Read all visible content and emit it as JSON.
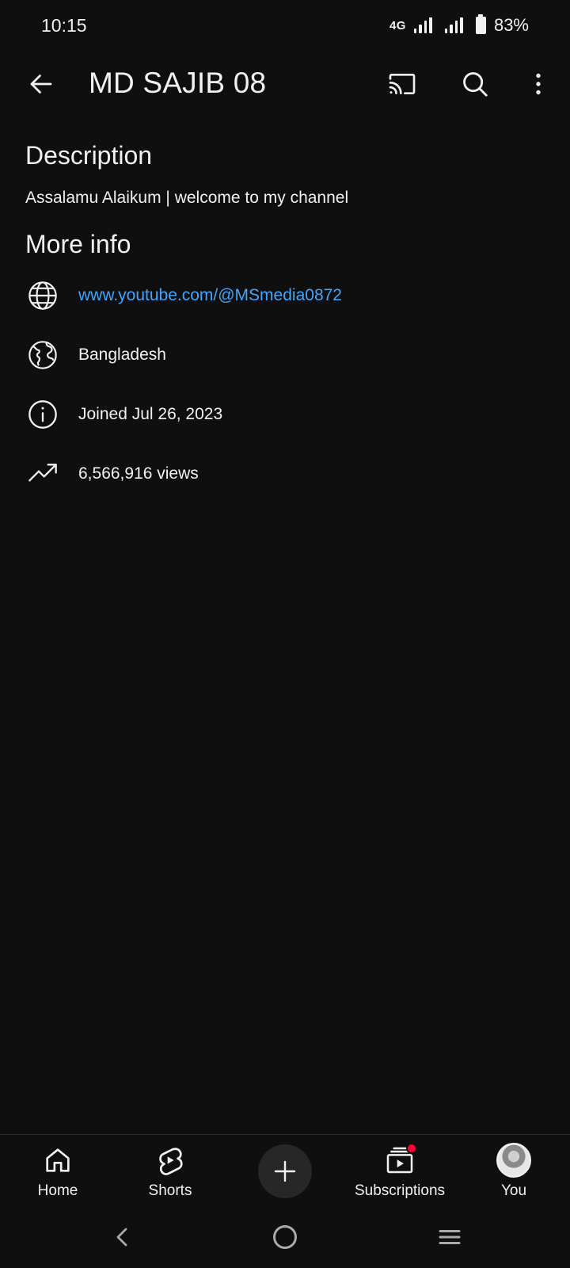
{
  "status_bar": {
    "time": "10:15",
    "network_type": "4G",
    "battery_percent": "83%"
  },
  "app_bar": {
    "title": "MD SAJIB 08",
    "icons": [
      "back-arrow-icon",
      "cast-icon",
      "search-icon",
      "more-vertical-icon"
    ]
  },
  "description": {
    "heading": "Description",
    "text": "Assalamu Alaikum | welcome to my channel"
  },
  "more_info": {
    "heading": "More info",
    "items": [
      {
        "icon": "globe-icon",
        "text": "www.youtube.com/@MSmedia0872",
        "is_link": true
      },
      {
        "icon": "earth-region-icon",
        "text": "Bangladesh",
        "is_link": false
      },
      {
        "icon": "info-icon",
        "text": "Joined Jul 26, 2023",
        "is_link": false
      },
      {
        "icon": "trending-up-icon",
        "text": "6,566,916 views",
        "is_link": false
      }
    ]
  },
  "bottom_nav": {
    "items": [
      {
        "label": "Home",
        "icon": "home-icon"
      },
      {
        "label": "Shorts",
        "icon": "shorts-icon"
      },
      {
        "label": "",
        "icon": "create-plus-icon"
      },
      {
        "label": "Subscriptions",
        "icon": "subscriptions-icon",
        "has_notification": true
      },
      {
        "label": "You",
        "icon": "avatar"
      }
    ]
  },
  "colors": {
    "background": "#0f0f0f",
    "text": "#f1f1f1",
    "link": "#3ea6ff",
    "notification": "#ff0033"
  }
}
